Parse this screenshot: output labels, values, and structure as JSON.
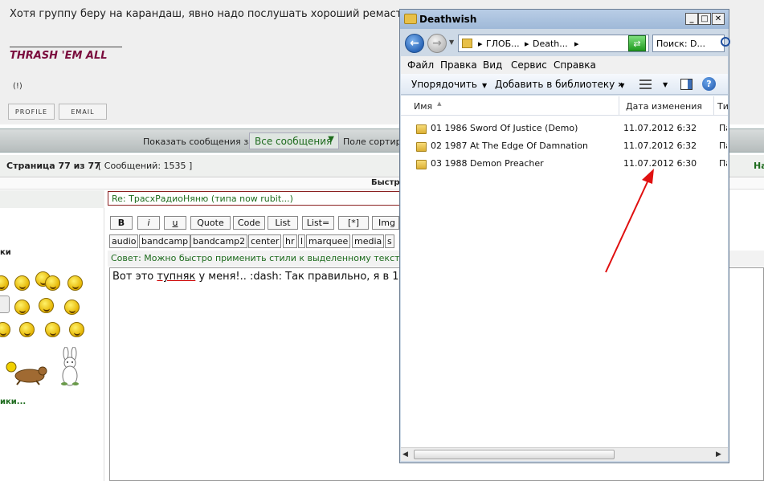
{
  "forum": {
    "post_text": "Хотя группу беру на карандаш, явно надо послушать хороший ремасте",
    "signature": "THRASH 'EM ALL",
    "paren_link": "(!)",
    "profile_btn": "PROFILE",
    "email_btn": "EMAIL",
    "show_label": "Показать сообщения за:",
    "show_select": "Все сообщения",
    "sort_label": "Поле сортиро",
    "page_label": "Страница 77 из 77",
    "msg_count": "[ Сообщений: 1535 ]",
    "page_na": "На",
    "quick_reply": "Быстр",
    "smiles_label": "ки",
    "more_smiles": "ики...",
    "subject_value": "Re: ТрасхРадиоНяню (типа now rubit...)",
    "bb_buttons": [
      "B",
      "i",
      "u",
      "Quote",
      "Code",
      "List",
      "List=",
      "[*]",
      "Img"
    ],
    "tag_buttons": [
      "audio",
      "bandcamp",
      "bandcamp2",
      "center",
      "hr",
      "l",
      "marquee",
      "media",
      "s"
    ],
    "tip": "Совет: Можно быстро применить стили к выделенному тексту",
    "editor_pre": "Вот это ",
    "editor_u": "тупняк",
    "editor_post": " у меня!.. :dash: Так правильно, я в 1"
  },
  "explorer": {
    "title": "Deathwish",
    "address": [
      "ГЛОБ...",
      "Death..."
    ],
    "search_placeholder": "Поиск: D...",
    "menu": [
      "Файл",
      "Правка",
      "Вид",
      "Сервис",
      "Справка"
    ],
    "toolbar": {
      "organize": "Упорядочить",
      "add_library": "Добавить в библиотеку",
      "more": "»"
    },
    "columns": {
      "name": "Имя",
      "date": "Дата изменения",
      "type": "Ти"
    },
    "files": [
      {
        "name": "01 1986 Sword Of Justice (Demo)",
        "date": "11.07.2012 6:32",
        "type": "Па"
      },
      {
        "name": "02 1987 At The Edge Of Damnation",
        "date": "11.07.2012 6:32",
        "type": "Па"
      },
      {
        "name": "03 1988 Demon Preacher",
        "date": "11.07.2012 6:30",
        "type": "Па"
      }
    ],
    "colors": {
      "title_bg": "#9fb9d8",
      "annotation_arrow": "#e01010"
    }
  }
}
